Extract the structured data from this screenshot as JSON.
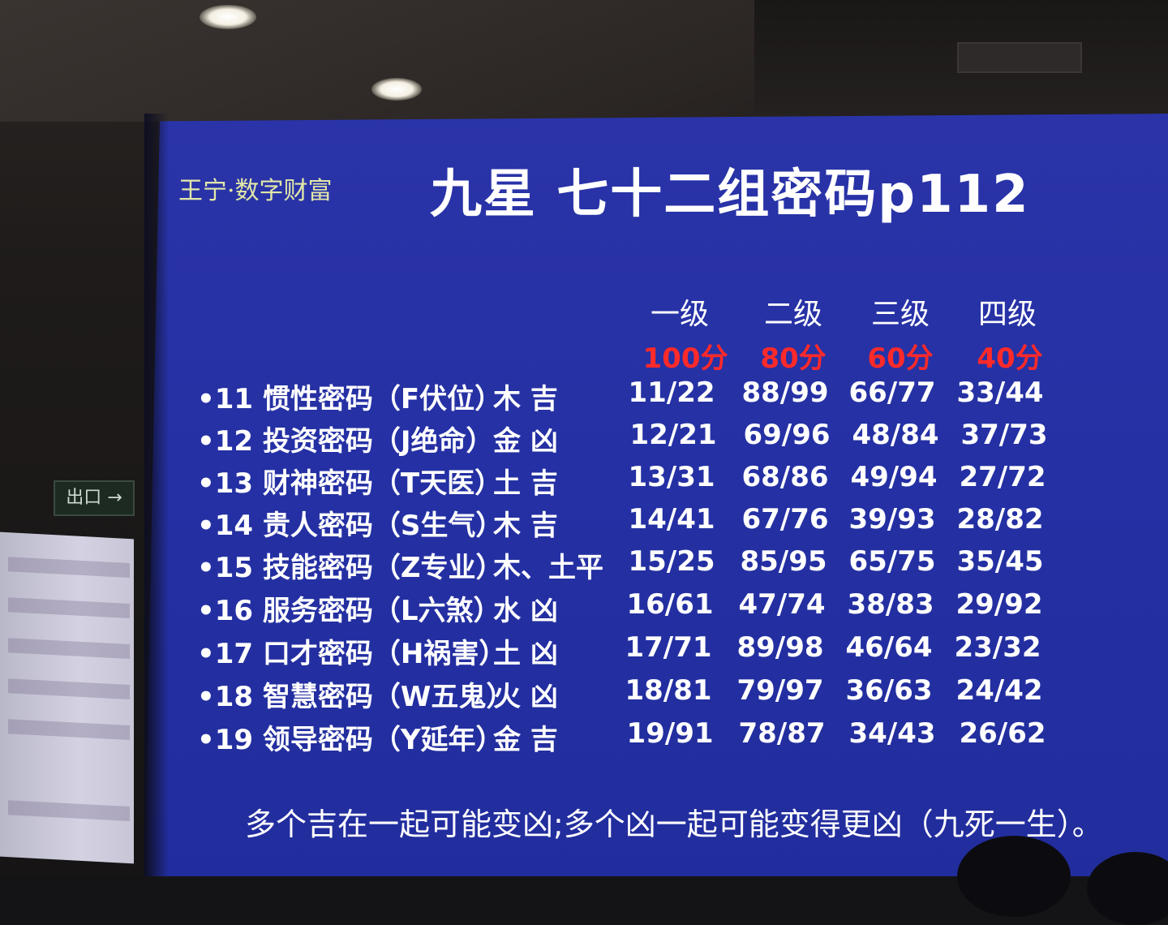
{
  "brand": "王宁·数字财富",
  "title": "九星 七十二组密码p112",
  "exit_sign": "出口 →",
  "columns": [
    {
      "level": "一级",
      "score": "100分"
    },
    {
      "level": "二级",
      "score": "80分"
    },
    {
      "level": "三级",
      "score": "60分"
    },
    {
      "level": "四级",
      "score": "40分"
    }
  ],
  "rows": [
    {
      "name": "•11 惯性密码（F伏位）",
      "element": "木 吉",
      "values": [
        "11/22",
        "88/99",
        "66/77",
        "33/44"
      ]
    },
    {
      "name": "•12 投资密码（J绝命）",
      "element": "金 凶",
      "values": [
        "12/21",
        "69/96",
        "48/84",
        "37/73"
      ]
    },
    {
      "name": "•13 财神密码（T天医）",
      "element": "土 吉",
      "values": [
        "13/31",
        "68/86",
        "49/94",
        "27/72"
      ]
    },
    {
      "name": "•14 贵人密码（S生气）",
      "element": "木 吉",
      "values": [
        "14/41",
        "67/76",
        "39/93",
        "28/82"
      ]
    },
    {
      "name": "•15 技能密码（Z专业）",
      "element": "木、土平",
      "values": [
        "15/25",
        "85/95",
        "65/75",
        "35/45"
      ]
    },
    {
      "name": "•16 服务密码（L六煞）",
      "element": "水 凶",
      "values": [
        "16/61",
        "47/74",
        "38/83",
        "29/92"
      ]
    },
    {
      "name": "•17 口才密码（H祸害）",
      "element": "土 凶",
      "values": [
        "17/71",
        "89/98",
        "46/64",
        "23/32"
      ]
    },
    {
      "name": "•18 智慧密码（W五鬼）",
      "element": "火 凶",
      "values": [
        "18/81",
        "79/97",
        "36/63",
        "24/42"
      ]
    },
    {
      "name": "•19 领导密码（Y延年）",
      "element": "金 吉",
      "values": [
        "19/91",
        "78/87",
        "34/43",
        "26/62"
      ]
    }
  ],
  "footer": "多个吉在一起可能变凶;多个凶一起可能变得更凶（九死一生）。"
}
